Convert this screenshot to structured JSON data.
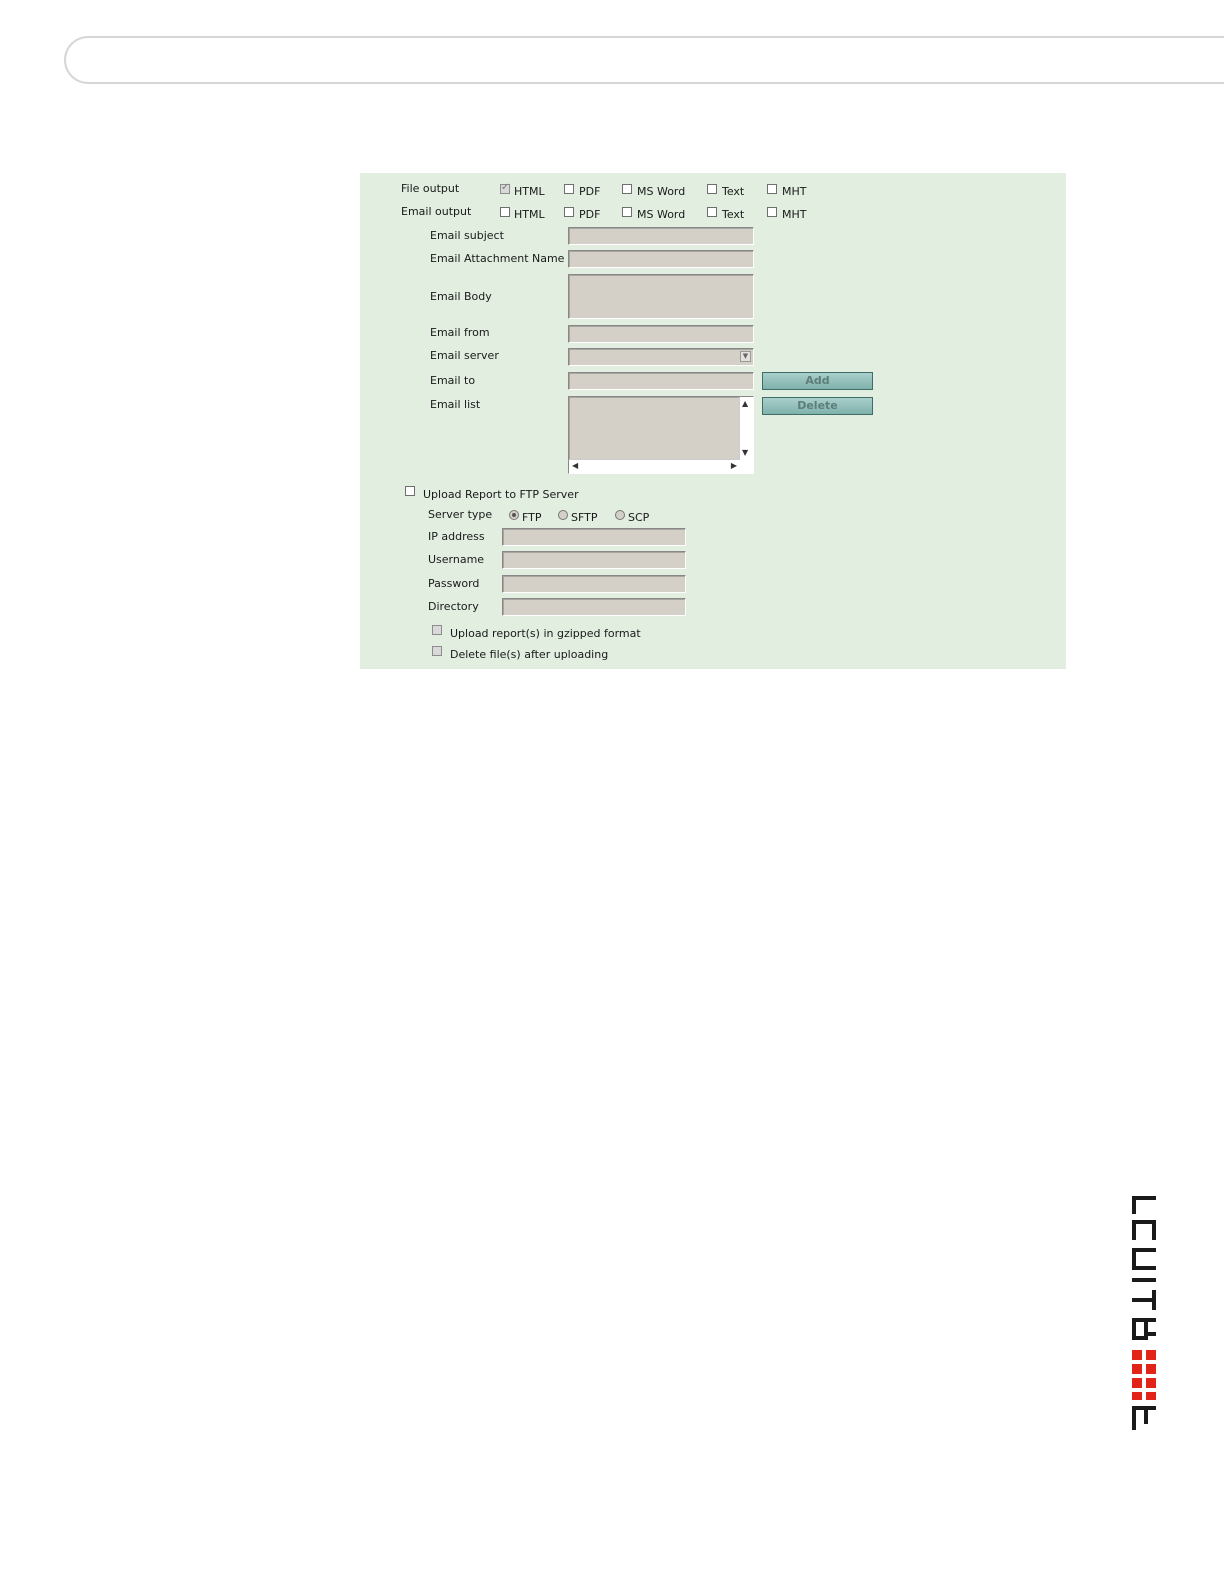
{
  "form": {
    "file_output": {
      "label": "File output",
      "options": [
        {
          "label": "HTML",
          "checked": true
        },
        {
          "label": "PDF",
          "checked": false
        },
        {
          "label": "MS Word",
          "checked": false
        },
        {
          "label": "Text",
          "checked": false
        },
        {
          "label": "MHT",
          "checked": false
        }
      ]
    },
    "email_output": {
      "label": "Email output",
      "options": [
        {
          "label": "HTML",
          "checked": false
        },
        {
          "label": "PDF",
          "checked": false
        },
        {
          "label": "MS Word",
          "checked": false
        },
        {
          "label": "Text",
          "checked": false
        },
        {
          "label": "MHT",
          "checked": false
        }
      ]
    },
    "email_subject": {
      "label": "Email subject",
      "value": ""
    },
    "email_attachment_name": {
      "label": "Email Attachment Name",
      "value": ""
    },
    "email_body": {
      "label": "Email Body",
      "value": ""
    },
    "email_from": {
      "label": "Email from",
      "value": ""
    },
    "email_server": {
      "label": "Email server",
      "selected": ""
    },
    "email_to": {
      "label": "Email to",
      "value": "",
      "add_label": "Add"
    },
    "email_list": {
      "label": "Email list",
      "delete_label": "Delete"
    },
    "ftp": {
      "upload_label": "Upload Report to FTP Server",
      "server_type": {
        "label": "Server type",
        "options": [
          "FTP",
          "SFTP",
          "SCP"
        ],
        "selected": "FTP"
      },
      "ip_address": {
        "label": "IP address",
        "value": ""
      },
      "username": {
        "label": "Username",
        "value": ""
      },
      "password": {
        "label": "Password",
        "value": ""
      },
      "directory": {
        "label": "Directory",
        "value": ""
      },
      "gzip_label": "Upload report(s) in gzipped format",
      "delete_label": "Delete file(s) after uploading"
    }
  },
  "brand": {
    "color": "#e2231a",
    "logo_icon": "fortinet-logo-icon"
  }
}
